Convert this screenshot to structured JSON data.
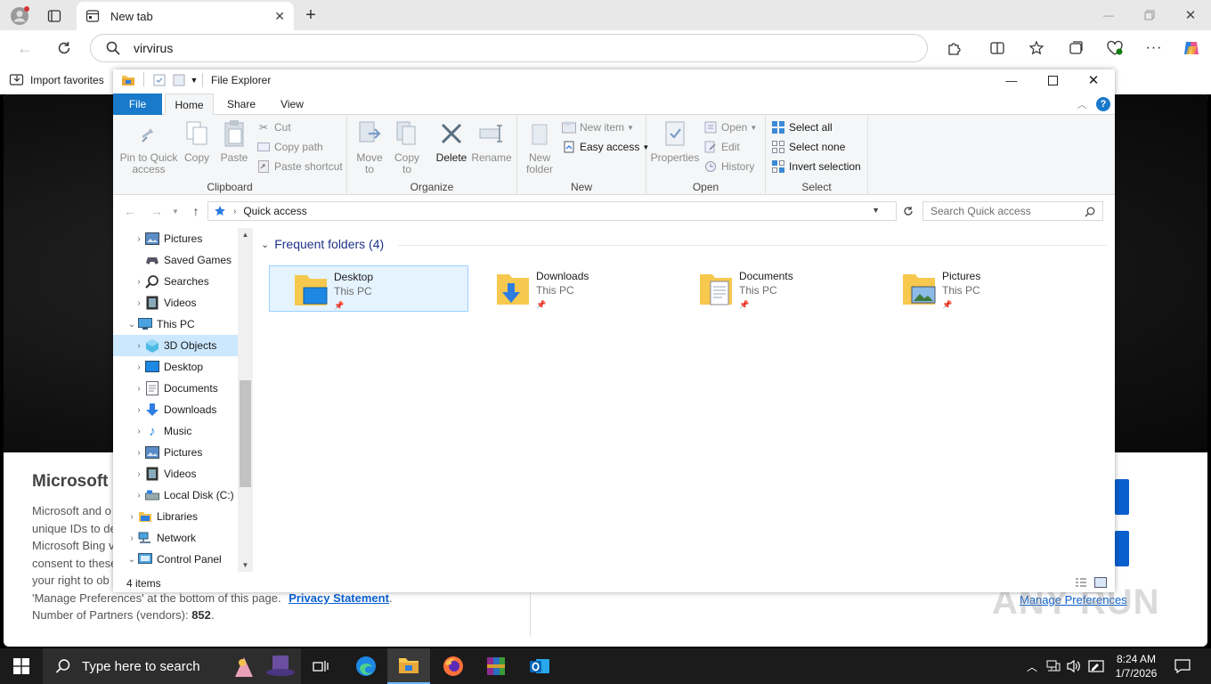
{
  "browser": {
    "tab_title": "New tab",
    "address": "virvirus",
    "favorites": {
      "import_label": "Import favorites"
    }
  },
  "page": {
    "heading_partial": "Microsoft (",
    "lines": [
      "Microsoft and o",
      "unique IDs to de",
      "Microsoft Bing v",
      "consent to these",
      "your right to ob"
    ],
    "manage_text": "'Manage Preferences' at the bottom of this page.",
    "privacy_link": "Privacy Statement",
    "privacy_period": ".",
    "partners_text": "Number of Partners (vendors):",
    "partners_count": "852",
    "partners_end": ".",
    "manage_link": "Manage Preferences"
  },
  "explorer": {
    "title": "File Explorer",
    "ribbon_tabs": [
      "File",
      "Home",
      "Share",
      "View"
    ],
    "clipboard": {
      "pin": "Pin to Quick access",
      "copy": "Copy",
      "paste": "Paste",
      "cut": "Cut",
      "copy_path": "Copy path",
      "paste_shortcut": "Paste shortcut",
      "label": "Clipboard"
    },
    "organize": {
      "move_to": "Move to",
      "copy_to": "Copy to",
      "delete": "Delete",
      "rename": "Rename",
      "label": "Organize"
    },
    "new": {
      "new_folder": "New folder",
      "new_item": "New item",
      "easy_access": "Easy access",
      "label": "New"
    },
    "open": {
      "properties": "Properties",
      "open": "Open",
      "edit": "Edit",
      "history": "History",
      "label": "Open"
    },
    "select": {
      "select_all": "Select all",
      "select_none": "Select none",
      "invert": "Invert selection",
      "label": "Select"
    },
    "breadcrumb": "Quick access",
    "search_placeholder": "Search Quick access",
    "tree": [
      "Pictures",
      "Saved Games",
      "Searches",
      "Videos",
      "This PC",
      "3D Objects",
      "Desktop",
      "Documents",
      "Downloads",
      "Music",
      "Pictures",
      "Videos",
      "Local Disk (C:)",
      "Libraries",
      "Network",
      "Control Panel"
    ],
    "section_title": "Frequent folders (4)",
    "folders": [
      {
        "name": "Desktop",
        "location": "This PC"
      },
      {
        "name": "Downloads",
        "location": "This PC"
      },
      {
        "name": "Documents",
        "location": "This PC"
      },
      {
        "name": "Pictures",
        "location": "This PC"
      }
    ],
    "status": "4 items"
  },
  "taskbar": {
    "search_placeholder": "Type here to search",
    "time": "8:24 AM",
    "date": "1/7/2026"
  },
  "watermark": "ANY RUN",
  "colors": {
    "accent": "#0078d4",
    "file_tab": "#1979ca",
    "selected": "#cce8ff",
    "taskbar": "#1b1b1b",
    "folder": "#f6c84e"
  }
}
